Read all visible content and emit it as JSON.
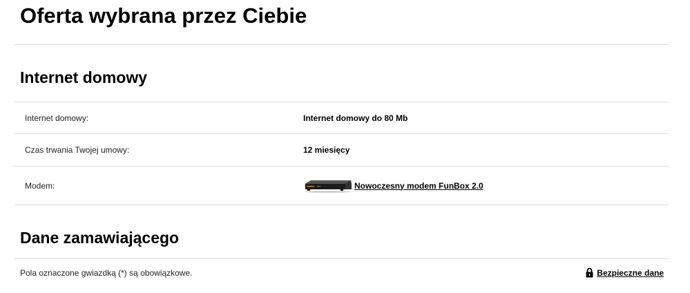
{
  "page": {
    "title": "Oferta wybrana przez Ciebie"
  },
  "internet_section": {
    "title": "Internet domowy",
    "rows": [
      {
        "label": "Internet domowy:",
        "value": "Internet domowy do 80 Mb"
      },
      {
        "label": "Czas trwania Twojej umowy:",
        "value": "12 miesięcy"
      },
      {
        "label": "Modem:",
        "value": "Nowoczesny modem FunBox 2.0",
        "icon": "modem-image"
      }
    ]
  },
  "orderer_section": {
    "title": "Dane zamawiającego",
    "required_note": "Pola oznaczone gwiazdką (*) są obowiązkowe.",
    "secure_data_link": "Bezpieczne dane",
    "secure_icon": "lock-icon"
  },
  "colors": {
    "text": "#000000",
    "divider": "#d9d9d9",
    "accent": "#ff7900"
  }
}
